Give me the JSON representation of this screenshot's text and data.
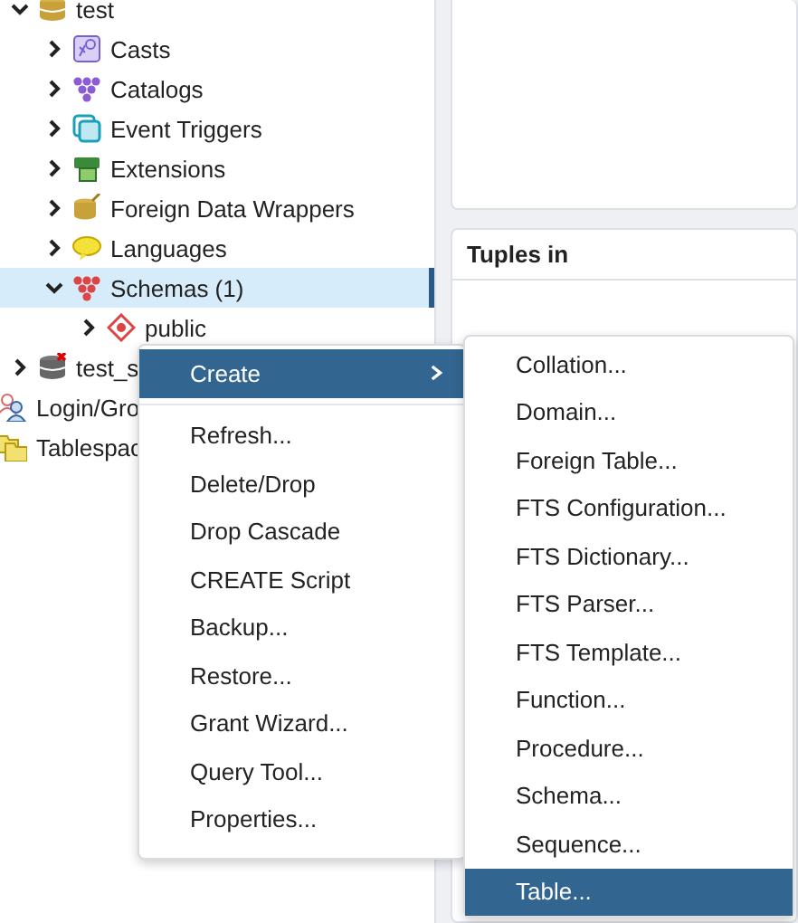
{
  "tree": [
    {
      "label": "test",
      "kind": "database",
      "expanded": true,
      "selected": false,
      "children": [
        {
          "label": "Casts",
          "kind": "casts",
          "expanded": false,
          "selected": false
        },
        {
          "label": "Catalogs",
          "kind": "catalogs",
          "expanded": false,
          "selected": false
        },
        {
          "label": "Event Triggers",
          "kind": "triggers",
          "expanded": false,
          "selected": false
        },
        {
          "label": "Extensions",
          "kind": "extensions",
          "expanded": false,
          "selected": false
        },
        {
          "label": "Foreign Data Wrappers",
          "kind": "fdw",
          "expanded": false,
          "selected": false
        },
        {
          "label": "Languages",
          "kind": "languages",
          "expanded": false,
          "selected": false
        },
        {
          "label": "Schemas (1)",
          "kind": "catalogs",
          "expanded": true,
          "selected": true,
          "children": [
            {
              "label": "public",
              "kind": "schema",
              "expanded": false,
              "selected": false
            }
          ]
        }
      ]
    },
    {
      "label": "test_s",
      "kind": "database_off",
      "expanded": false,
      "selected": false
    },
    {
      "label": "Login/Gro",
      "kind": "roles",
      "selected": false
    },
    {
      "label": "Tablespac",
      "kind": "tablespaces",
      "selected": false
    }
  ],
  "dashboard": {
    "panel_title": "Tuples in"
  },
  "context_menu": [
    {
      "label": "Create",
      "selected": true,
      "submenu": true,
      "separator_after": true
    },
    {
      "label": "Refresh...",
      "selected": false
    },
    {
      "label": "Delete/Drop",
      "selected": false
    },
    {
      "label": "Drop Cascade",
      "selected": false
    },
    {
      "label": "CREATE Script",
      "selected": false
    },
    {
      "label": "Backup...",
      "selected": false
    },
    {
      "label": "Restore...",
      "selected": false
    },
    {
      "label": "Grant Wizard...",
      "selected": false
    },
    {
      "label": "Query Tool...",
      "selected": false
    },
    {
      "label": "Properties...",
      "selected": false
    }
  ],
  "submenu": [
    {
      "label": "Collation...",
      "selected": false
    },
    {
      "label": "Domain...",
      "selected": false
    },
    {
      "label": "Foreign Table...",
      "selected": false
    },
    {
      "label": "FTS Configuration...",
      "selected": false
    },
    {
      "label": "FTS Dictionary...",
      "selected": false
    },
    {
      "label": "FTS Parser...",
      "selected": false
    },
    {
      "label": "FTS Template...",
      "selected": false
    },
    {
      "label": "Function...",
      "selected": false
    },
    {
      "label": "Procedure...",
      "selected": false
    },
    {
      "label": "Schema...",
      "selected": false
    },
    {
      "label": "Sequence...",
      "selected": false
    },
    {
      "label": "Table...",
      "selected": true
    }
  ]
}
